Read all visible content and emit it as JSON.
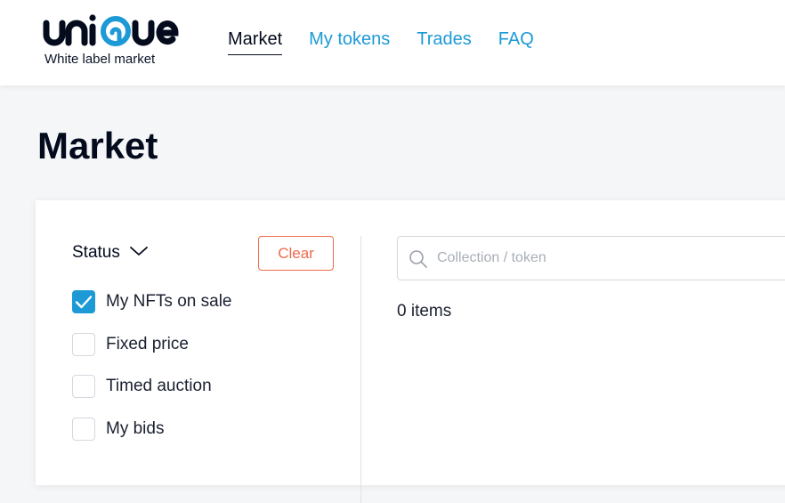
{
  "brand": {
    "logo_text": "unique",
    "tagline": "White label market"
  },
  "nav": {
    "items": [
      {
        "label": "Market",
        "active": true
      },
      {
        "label": "My tokens",
        "active": false
      },
      {
        "label": "Trades",
        "active": false
      },
      {
        "label": "FAQ",
        "active": false
      }
    ]
  },
  "page": {
    "title": "Market"
  },
  "filters": {
    "status_label": "Status",
    "clear_label": "Clear",
    "options": [
      {
        "label": "My NFTs on sale",
        "checked": true
      },
      {
        "label": "Fixed price",
        "checked": false
      },
      {
        "label": "Timed auction",
        "checked": false
      },
      {
        "label": "My bids",
        "checked": false
      }
    ]
  },
  "search": {
    "placeholder": "Collection / token",
    "value": ""
  },
  "results": {
    "count_text": "0 items"
  },
  "colors": {
    "accent": "#1d9ad6",
    "clear": "#f06a4c",
    "text_dark": "#040b1d"
  },
  "icons": {
    "status_toggle": "chevron-down-icon",
    "search": "search-icon",
    "checked": "checkmark-icon"
  }
}
